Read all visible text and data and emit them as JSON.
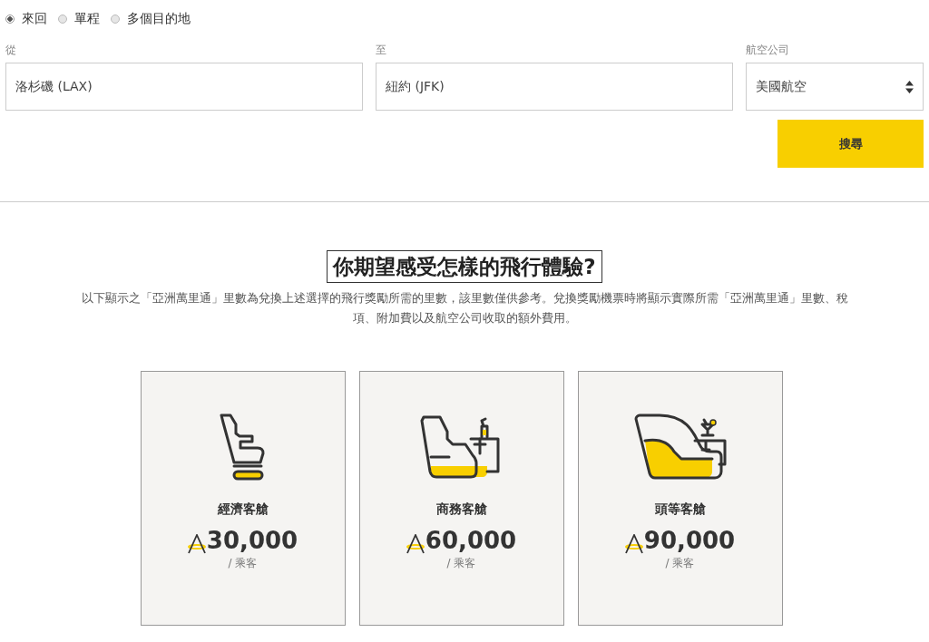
{
  "trip_types": [
    {
      "label": "來回",
      "selected": true
    },
    {
      "label": "單程",
      "selected": false
    },
    {
      "label": "多個目的地",
      "selected": false
    }
  ],
  "fields": [
    {
      "label": "從",
      "value": "洛杉磯 (LAX)",
      "kind": "text"
    },
    {
      "label": "至",
      "value": "紐約 (JFK)",
      "kind": "text"
    },
    {
      "label": "航空公司",
      "value": "美國航空",
      "kind": "select"
    }
  ],
  "search_button": "搜尋",
  "heading": "你期望感受怎樣的飛行體驗?",
  "description": "以下顯示之「亞洲萬里通」里數為兌換上述選擇的飛行獎勵所需的里數，該里數僅供參考。兌換獎勵機票時將顯示實際所需「亞洲萬里通」里數、稅項、附加費以及航空公司收取的額外費用。",
  "cabins": [
    {
      "kind": "economy",
      "name": "經濟客艙",
      "miles": "30,000",
      "unit": "/ 乘客"
    },
    {
      "kind": "business",
      "name": "商務客艙",
      "miles": "60,000",
      "unit": "/ 乘客"
    },
    {
      "kind": "first",
      "name": "頭等客艙",
      "miles": "90,000",
      "unit": "/ 乘客"
    }
  ]
}
